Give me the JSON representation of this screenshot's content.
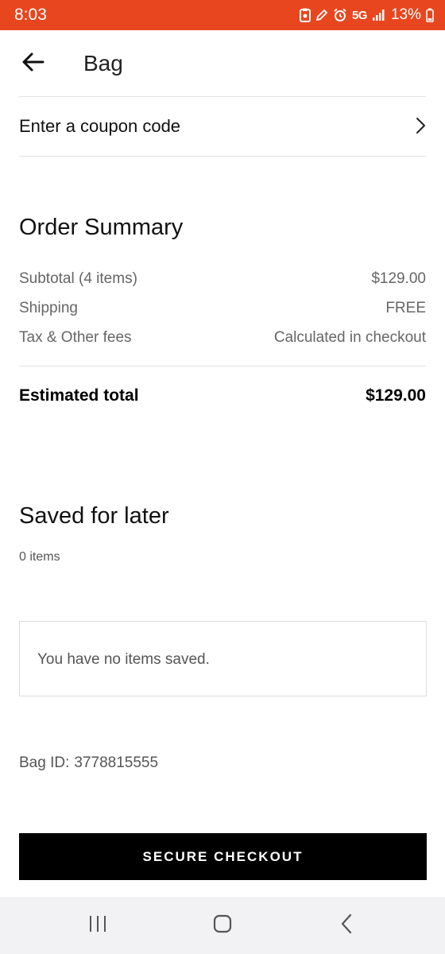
{
  "status_bar": {
    "time": "8:03",
    "network": "5G",
    "battery": "13%"
  },
  "header": {
    "title": "Bag"
  },
  "coupon": {
    "label": "Enter a coupon code"
  },
  "order_summary": {
    "title": "Order Summary",
    "rows": [
      {
        "label": "Subtotal (4 items)",
        "value": "$129.00"
      },
      {
        "label": "Shipping",
        "value": "FREE"
      },
      {
        "label": "Tax & Other fees",
        "value": "Calculated in checkout"
      }
    ],
    "total_label": "Estimated total",
    "total_value": "$129.00"
  },
  "saved_for_later": {
    "title": "Saved for later",
    "count": "0 items",
    "empty_message": "You have no items saved."
  },
  "bag": {
    "id_label": "Bag ID:",
    "id_value": "3778815555"
  },
  "checkout": {
    "label": "SECURE CHECKOUT"
  },
  "colors": {
    "status_bar": "#e8461f",
    "checkout_button": "#000000"
  },
  "icons": {
    "back": "arrow-left-icon",
    "coupon": "chevron-right-icon",
    "nav_recents": "recent-apps-icon",
    "nav_home": "home-icon",
    "nav_back": "nav-back-icon"
  }
}
